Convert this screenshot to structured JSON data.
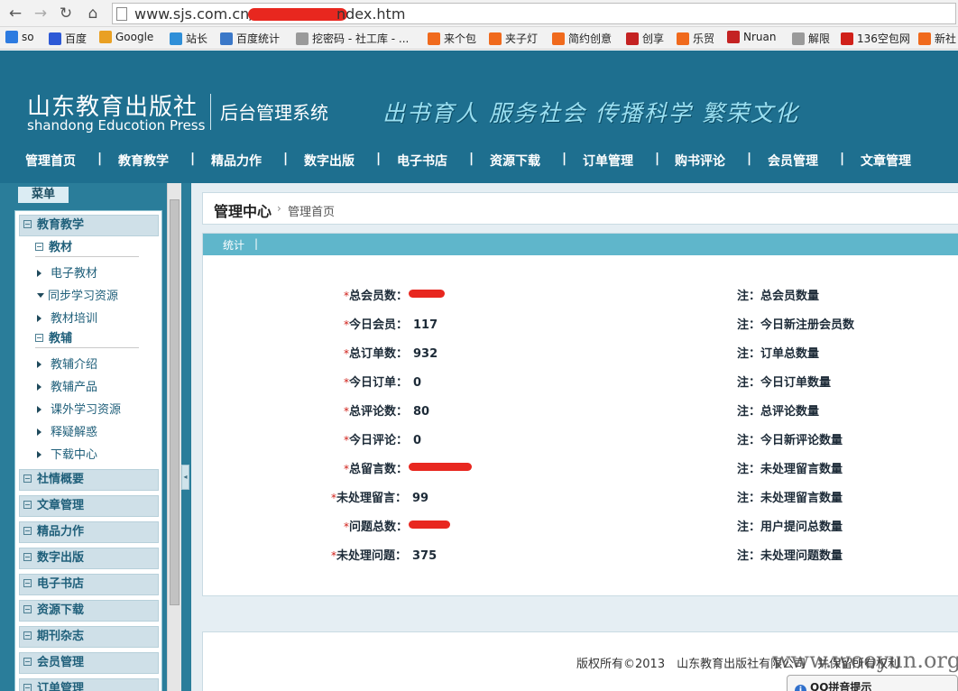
{
  "browser": {
    "url_start": "www.sjs.com.cn/",
    "url_end": "ndex.htm",
    "bookmarks": [
      {
        "label": "so",
        "color": "#2d7be0"
      },
      {
        "label": "百度",
        "color": "#2d59d6"
      },
      {
        "label": "Google",
        "color": "#e9a023"
      },
      {
        "label": "站长",
        "color": "#2f8fd8"
      },
      {
        "label": "百度统计",
        "color": "#3b78c8"
      },
      {
        "label": "挖密码 - 社工库 - ...",
        "color": "#9a9a9a"
      },
      {
        "label": "来个包",
        "color": "#f06a1d"
      },
      {
        "label": "夹子灯",
        "color": "#f06a1d"
      },
      {
        "label": "简约创意",
        "color": "#f06a1d"
      },
      {
        "label": "创享",
        "color": "#c42323"
      },
      {
        "label": "乐贸",
        "color": "#f06a1d"
      },
      {
        "label": "Nruan",
        "color": "#c42323"
      },
      {
        "label": "解限",
        "color": "#9a9a9a"
      },
      {
        "label": "136空包网",
        "color": "#d0211a"
      },
      {
        "label": "新社",
        "color": "#f06a1d"
      }
    ]
  },
  "header": {
    "logo_cn": "山东教育出版社",
    "logo_en": "shandong Educotion Press",
    "system_name": "后台管理系统",
    "slogan": "出书育人 服务社会 传播科学 繁荣文化",
    "nav": [
      "管理首页",
      "教育教学",
      "精品力作",
      "数字出版",
      "电子书店",
      "资源下载",
      "订单管理",
      "购书评论",
      "会员管理",
      "文章管理"
    ],
    "nav_separator": "|"
  },
  "sidebar": {
    "tab_label": "菜单",
    "cat_education": "教育教学",
    "sub_textbook": "教材",
    "textbook_items": [
      "电子教材",
      "同步学习资源",
      "教材培训"
    ],
    "sub_auxiliary": "教辅",
    "auxiliary_items": [
      "教辅介绍",
      "教辅产品",
      "课外学习资源",
      "释疑解惑",
      "下载中心"
    ],
    "other_cats": [
      "社情概要",
      "文章管理",
      "精品力作",
      "数字出版",
      "电子书店",
      "资源下载",
      "期刊杂志",
      "会员管理",
      "订单管理"
    ]
  },
  "breadcrumb": {
    "title": "管理中心",
    "arrow": "›",
    "sub": "管理首页"
  },
  "stats": {
    "tab_label": "统计",
    "tab_separator": "|",
    "star": "*",
    "rows": [
      {
        "label": "总会员数：",
        "value": "",
        "note": "注：总会员数量"
      },
      {
        "label": "今日会员：",
        "value": "117",
        "note": "注：今日新注册会员数"
      },
      {
        "label": "总订单数：",
        "value": "932",
        "note": "注：订单总数量"
      },
      {
        "label": "今日订单：",
        "value": "0",
        "note": "注：今日订单数量"
      },
      {
        "label": "总评论数：",
        "value": "80",
        "note": "注：总评论数量"
      },
      {
        "label": "今日评论：",
        "value": "0",
        "note": "注：今日新评论数量"
      },
      {
        "label": "总留言数：",
        "value": "",
        "note": "注：未处理留言数量"
      },
      {
        "label": "未处理留言：",
        "value": "99",
        "note": "注：未处理留言数量"
      },
      {
        "label": "问题总数：",
        "value": "",
        "note": "注：用户提问总数量"
      },
      {
        "label": "未处理问题：",
        "value": "375",
        "note": "注：未处理问题数量"
      }
    ]
  },
  "footer": {
    "text": "版权所有©2013　山东教育出版社有限公司　并保留所有权利"
  },
  "overlay": {
    "watermark": "www.wooyun.org",
    "qq_popup": "QQ拼音提示",
    "qq_icon": "i"
  }
}
